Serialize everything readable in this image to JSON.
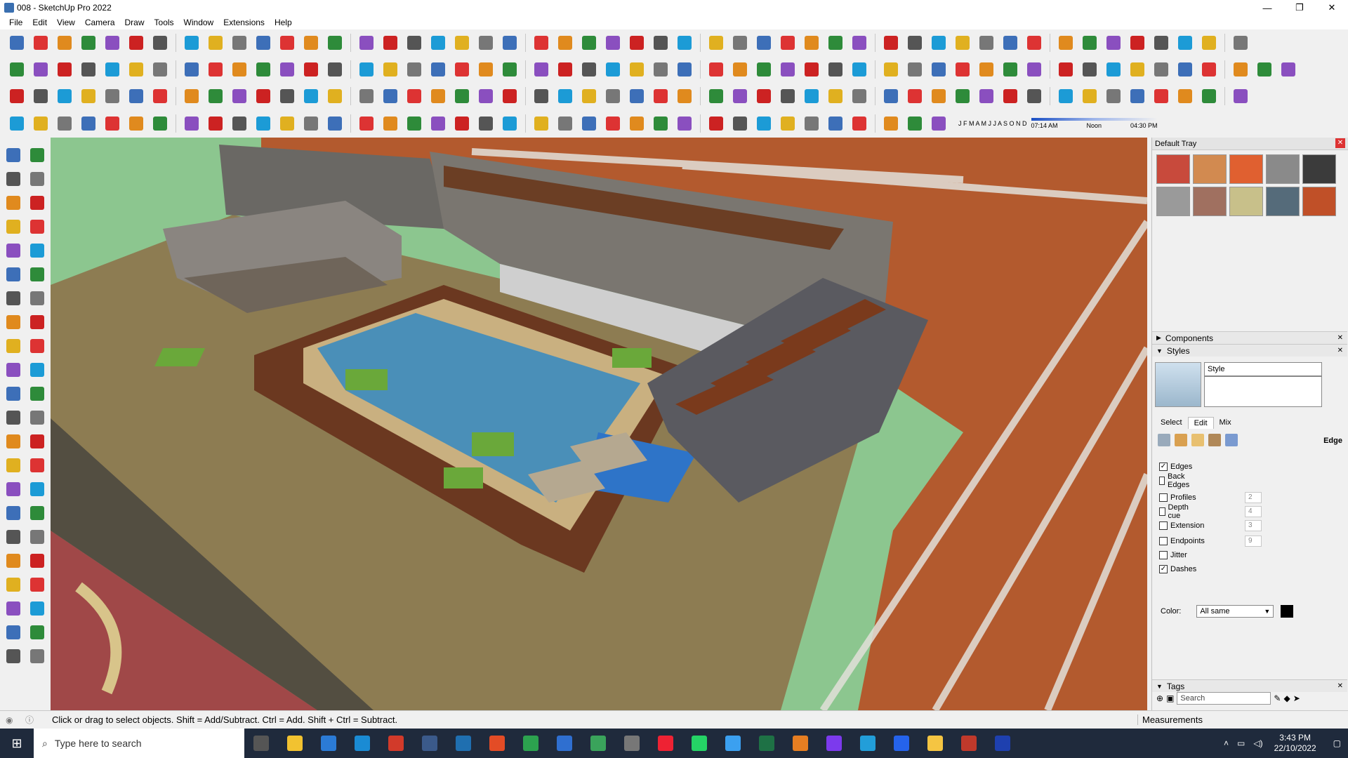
{
  "window": {
    "title": "008 - SketchUp Pro 2022",
    "minimize": "—",
    "maximize": "❐",
    "close": "✕"
  },
  "menu": [
    "File",
    "Edit",
    "View",
    "Camera",
    "Draw",
    "Tools",
    "Window",
    "Extensions",
    "Help"
  ],
  "toolbar_colors": [
    "#3d6fb8",
    "#d33",
    "#e08a1e",
    "#2e8b3a",
    "#8a4fbf",
    "#c22",
    "#555",
    "#1c9bd6",
    "#e0b020",
    "#777"
  ],
  "shadow": {
    "months": "J F M A M J J A S O N D",
    "time_start": "07:14 AM",
    "time_mid": "Noon",
    "time_end": "04:30 PM"
  },
  "tray": {
    "title": "Default Tray",
    "materials": [
      "#c84a3c",
      "#d28a50",
      "#e06030",
      "#8a8a8a",
      "#3b3b3b",
      "#9a9a9a",
      "#a07060",
      "#c8c08a",
      "#556b7a",
      "#c05028"
    ],
    "components_label": "Components",
    "styles_label": "Styles",
    "style_name": "Style",
    "tabs": [
      "Select",
      "Edit",
      "Mix"
    ],
    "edit_section": "Edge",
    "options": [
      {
        "label": "Edges",
        "checked": true,
        "value": ""
      },
      {
        "label": "Back Edges",
        "checked": false,
        "value": ""
      },
      {
        "label": "Profiles",
        "checked": false,
        "value": "2"
      },
      {
        "label": "Depth cue",
        "checked": false,
        "value": "4"
      },
      {
        "label": "Extension",
        "checked": false,
        "value": "3"
      },
      {
        "label": "Endpoints",
        "checked": false,
        "value": "9"
      },
      {
        "label": "Jitter",
        "checked": false,
        "value": ""
      },
      {
        "label": "Dashes",
        "checked": true,
        "value": ""
      }
    ],
    "color_label": "Color:",
    "color_value": "All same",
    "tags_label": "Tags",
    "tags_search_placeholder": "Search"
  },
  "status": {
    "hint": "Click or drag to select objects. Shift = Add/Subtract. Ctrl = Add. Shift + Ctrl = Subtract.",
    "measurements": "Measurements"
  },
  "taskbar": {
    "search_placeholder": "Type here to search",
    "time": "3:43 PM",
    "date": "22/10/2022"
  },
  "scene": {
    "sky": "#8cc68f",
    "deck": "#8d7c52",
    "pool": "#4a8fb8",
    "grass": "#6aa83a",
    "wood": "#8b4a2a",
    "stone": "#7a7670",
    "carpet": "#a04848"
  }
}
